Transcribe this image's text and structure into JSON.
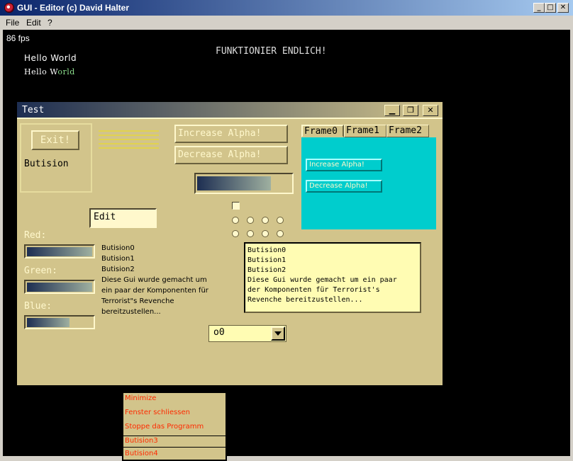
{
  "os_window": {
    "title": "GUI - Editor (c) David Halter",
    "minimize": "_",
    "maximize": "□",
    "close": "✕",
    "menu": [
      "File",
      "Edit",
      "?"
    ]
  },
  "canvas": {
    "fps": "86 fps",
    "hello_world_1": "Hello World",
    "hello_world_2a": "Hello W",
    "hello_world_2b": "orld",
    "banner": "FUNKTIONIER ENDLICH!"
  },
  "gui_window": {
    "title": "Test",
    "minimize": "▁",
    "restore": "❐",
    "close": "✕",
    "exit_button": "Exit!",
    "butision_label": "Butision",
    "increase_alpha": "Increase Alpha!",
    "decrease_alpha": "Decrease Alpha!",
    "edit_value": "Edit",
    "tabs": [
      "Frame0",
      "Frame1",
      "Frame2"
    ],
    "tab_increase": "Increase Alpha!",
    "tab_decrease": "Decrease Alpha!",
    "red_label": "Red:",
    "green_label": "Green:",
    "blue_label": "Blue:",
    "red_level": 1.0,
    "green_level": 1.0,
    "blue_level": 0.65,
    "list_lines": [
      "Butision0",
      "Butision1",
      "Butision2",
      "Diese Gui wurde gemacht um",
      "ein paar der Komponenten für",
      "Terrorist\"s Revenche",
      "bereitzustellen..."
    ],
    "box_lines": [
      "Butision0",
      "Butision1",
      "Butision2",
      "Diese Gui wurde gemacht um ein paar",
      "der Komponenten für Terrorist's",
      "Revenche bereitzustellen..."
    ],
    "combo_value": "o0",
    "context_menu": [
      "Minimize",
      "Fenster schliessen",
      "Stoppe das Programm",
      "Butision3",
      "Butision4"
    ]
  },
  "colors": {
    "panel": "#d2c48b",
    "accent_cyan": "#00cdcd",
    "menu_text": "#ff2a00",
    "title_gradient_start": "#1d2e52"
  }
}
